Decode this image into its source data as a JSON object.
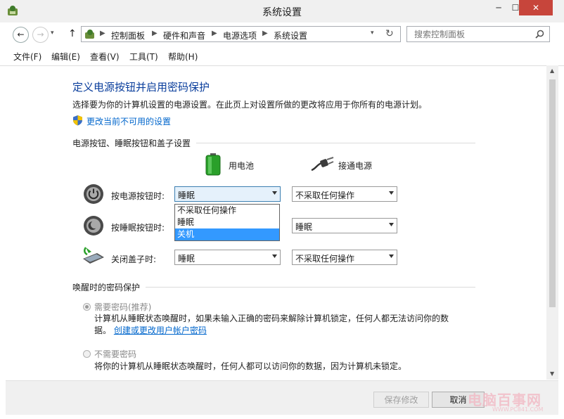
{
  "window": {
    "title": "系统设置",
    "minimize": "─",
    "maximize": "☐",
    "close": "✕"
  },
  "nav": {
    "back": "←",
    "forward": "→",
    "up": "↑",
    "breadcrumbs": [
      "控制面板",
      "硬件和声音",
      "电源选项",
      "系统设置"
    ],
    "search_placeholder": "搜索控制面板"
  },
  "menu": [
    "文件(F)",
    "编辑(E)",
    "查看(V)",
    "工具(T)",
    "帮助(H)"
  ],
  "page": {
    "heading": "定义电源按钮并启用密码保护",
    "intro": "选择要为你的计算机设置的电源设置。在此页上对设置所做的更改将应用于你所有的电源计划。",
    "admin_link": "更改当前不可用的设置"
  },
  "power_section": {
    "title": "电源按钮、睡眠按钮和盖子设置",
    "battery_label": "用电池",
    "plugged_label": "接通电源",
    "rows": [
      {
        "label": "按电源按钮时:",
        "battery": "睡眠",
        "plugged": "不采取任何操作"
      },
      {
        "label": "按睡眠按钮时:",
        "battery": "",
        "plugged": "睡眠"
      },
      {
        "label": "关闭盖子时:",
        "battery": "睡眠",
        "plugged": "不采取任何操作"
      }
    ],
    "dropdown_options": [
      "不采取任何操作",
      "睡眠",
      "关机"
    ],
    "dropdown_selected": "关机"
  },
  "password_section": {
    "title": "唤醒时的密码保护",
    "require": {
      "label": "需要密码(推荐)",
      "desc_line1": "计算机从睡眠状态唤醒时，如果未输入正确的密码来解除计算机锁定，任何人都无法访问你的数",
      "desc_line2_prefix": "据。",
      "desc_link": "创建或更改用户帐户密码"
    },
    "no_require": {
      "label": "不需要密码",
      "desc": "将你的计算机从睡眠状态唤醒时，任何人都可以访问你的数据，因为计算机未锁定。"
    }
  },
  "buttons": {
    "save": "保存修改",
    "cancel": "取消"
  },
  "watermark": {
    "main": "电脑百事网",
    "sub": "WWW.PC841.COM"
  },
  "colors": {
    "heading": "#0a3e9c",
    "link": "#0066cc",
    "close_button": "#c7453b",
    "selection": "#3399ff"
  }
}
